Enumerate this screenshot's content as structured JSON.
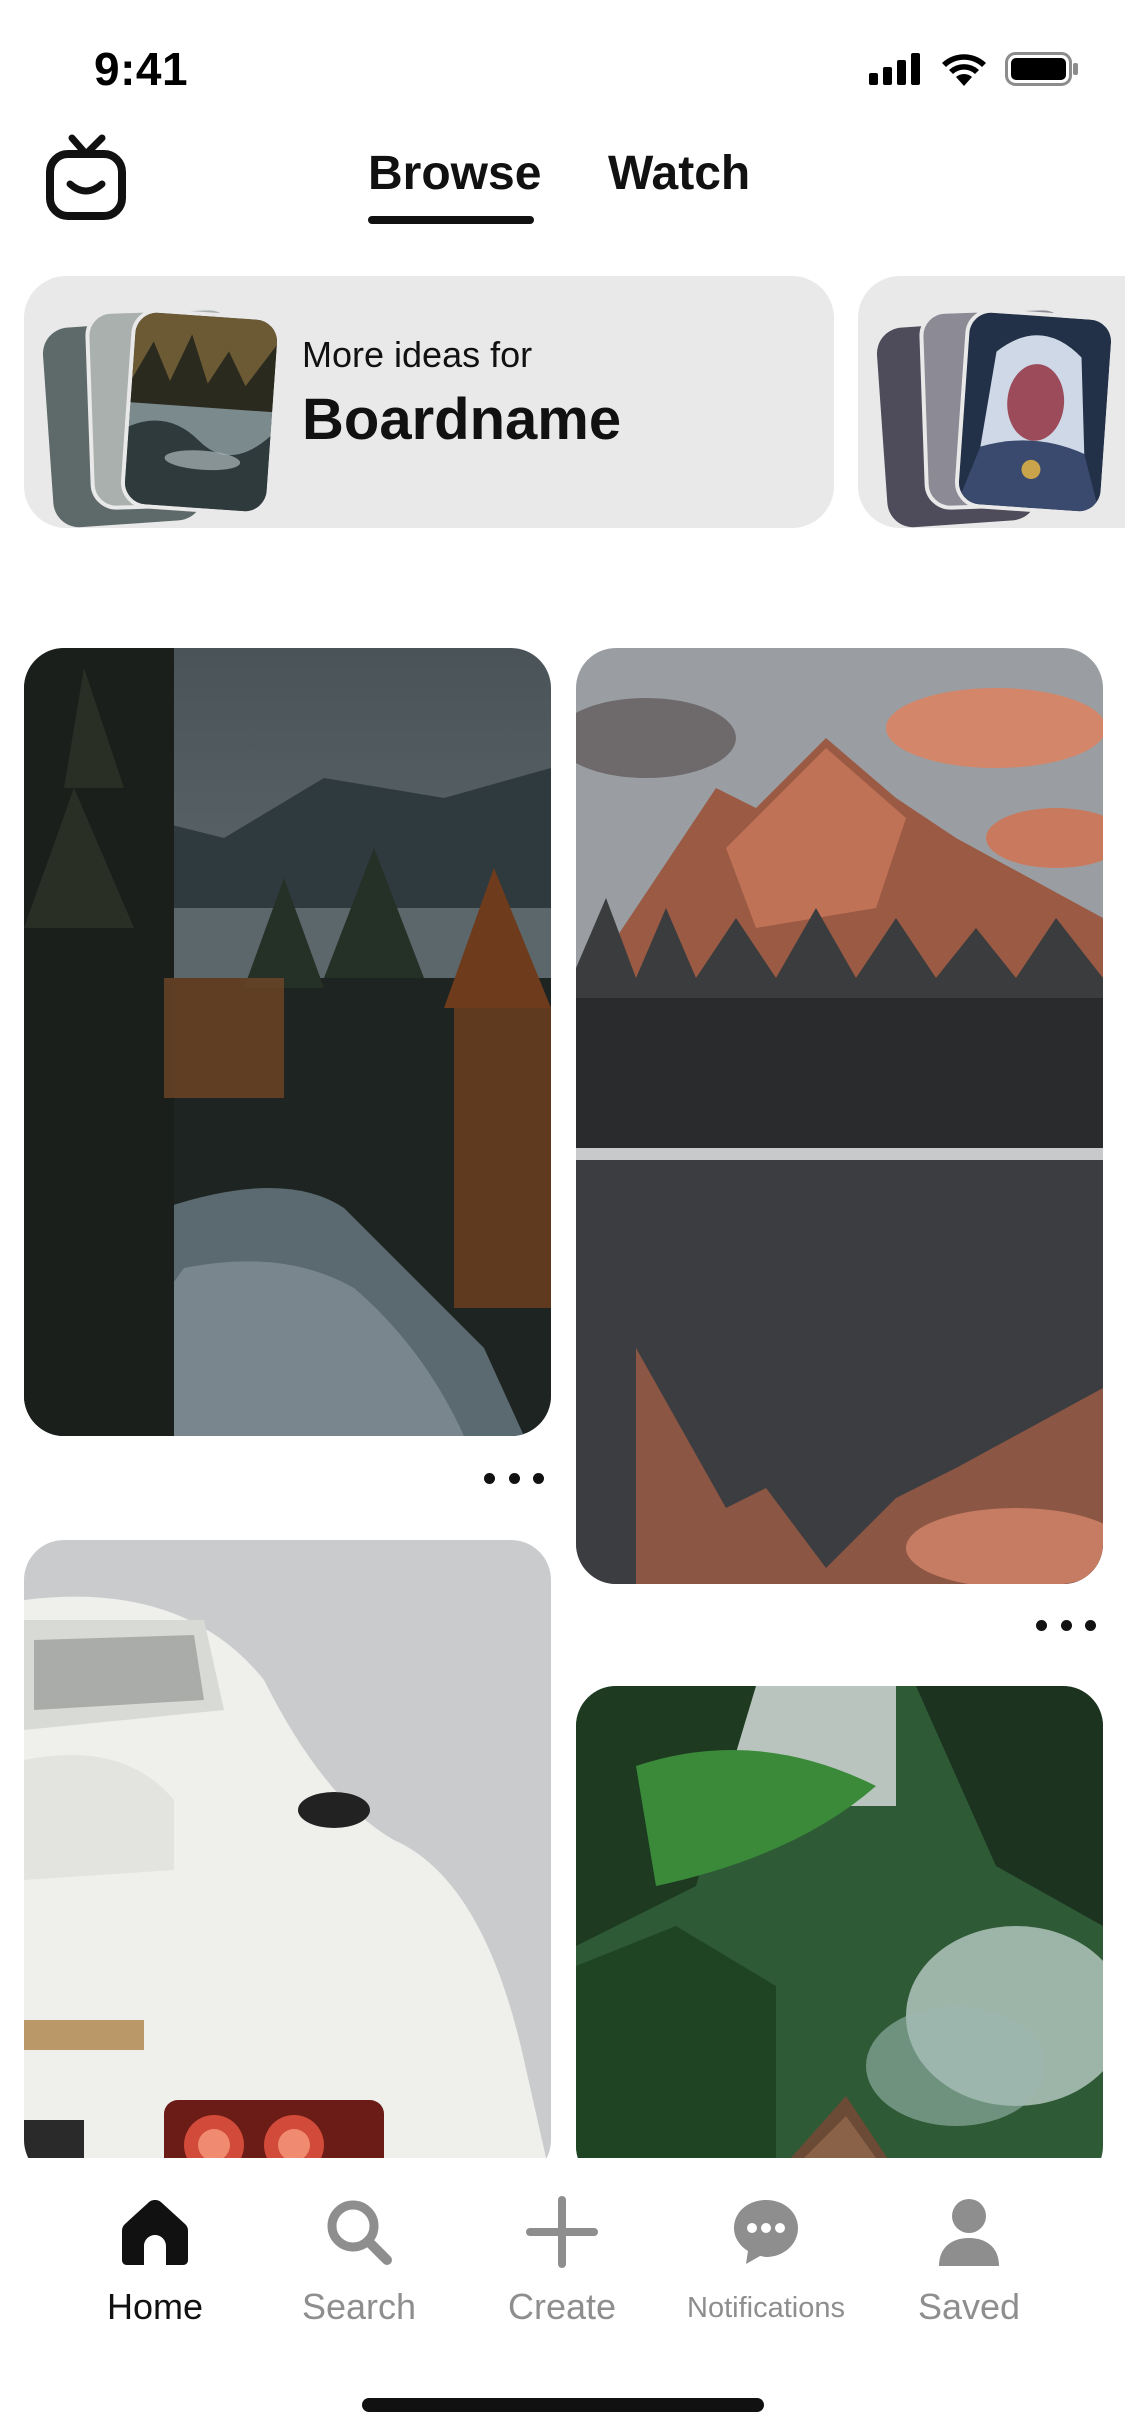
{
  "status_bar": {
    "time": "9:41"
  },
  "header": {
    "tabs": [
      {
        "label": "Browse",
        "selected": true
      },
      {
        "label": "Watch",
        "selected": false
      }
    ]
  },
  "ideas": [
    {
      "subtitle": "More ideas for",
      "title": "Boardname"
    }
  ],
  "pins": [
    {
      "image": "forest-river-photo"
    },
    {
      "image": "mountain-lake-reflection-photo"
    },
    {
      "image": "white-sports-car-photo"
    },
    {
      "image": "forest-cabin-smoke-photo"
    }
  ],
  "bottom_nav": {
    "items": [
      {
        "label": "Home",
        "icon": "home-icon",
        "active": true
      },
      {
        "label": "Search",
        "icon": "search-icon",
        "active": false
      },
      {
        "label": "Create",
        "icon": "plus-icon",
        "active": false
      },
      {
        "label": "Notifications",
        "icon": "chat-bubble-icon",
        "active": false
      },
      {
        "label": "Saved",
        "icon": "profile-icon",
        "active": false
      }
    ]
  },
  "colors": {
    "card_bg": "#e9e9e9",
    "inactive": "#8e8e8e",
    "active": "#111111"
  }
}
